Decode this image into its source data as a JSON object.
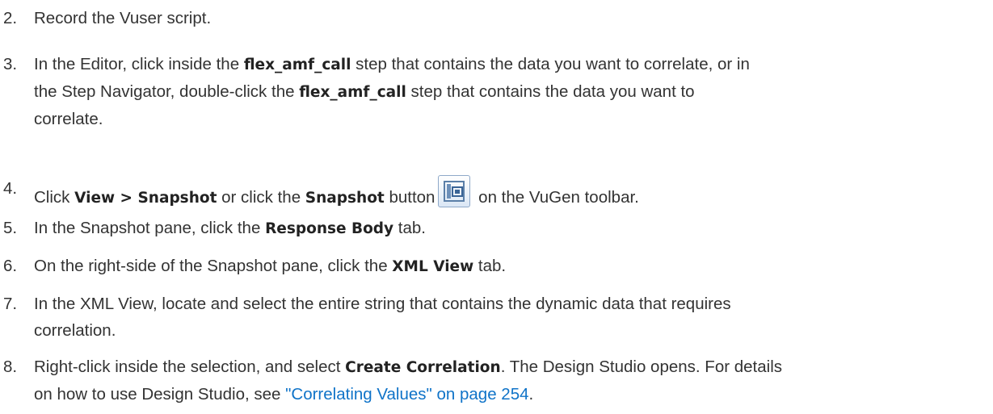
{
  "steps": [
    {
      "number": "2.",
      "text": "Record the Vuser script."
    },
    {
      "number": "3.",
      "parts": [
        "In the Editor, click inside the ",
        "flex_amf_call",
        " step that contains the data you want to correlate, or in",
        "the Step Navigator, double-click the ",
        "flex_amf_call",
        " step that contains the data you want to",
        "correlate."
      ]
    },
    {
      "number": "4.",
      "parts": [
        "Click ",
        "View > Snapshot",
        " or click the ",
        "Snapshot",
        " button",
        " on the VuGen toolbar."
      ],
      "icon": "snapshot-icon"
    },
    {
      "number": "5.",
      "parts": [
        "In the Snapshot pane, click the ",
        "Response Body",
        " tab."
      ]
    },
    {
      "number": "6.",
      "parts": [
        "On the right-side of the Snapshot pane, click the ",
        "XML View",
        " tab."
      ]
    },
    {
      "number": "7.",
      "parts": [
        "In the XML View, locate and select the entire string that contains the dynamic data that requires",
        "correlation."
      ]
    },
    {
      "number": "8.",
      "parts": [
        "Right-click inside the selection, and select ",
        "Create Correlation",
        ". The Design Studio opens. For details",
        "on how to use Design Studio, see ",
        "\"Correlating Values\" on page 254",
        "."
      ]
    }
  ],
  "colors": {
    "text": "#333333",
    "link": "#0f73c8"
  }
}
